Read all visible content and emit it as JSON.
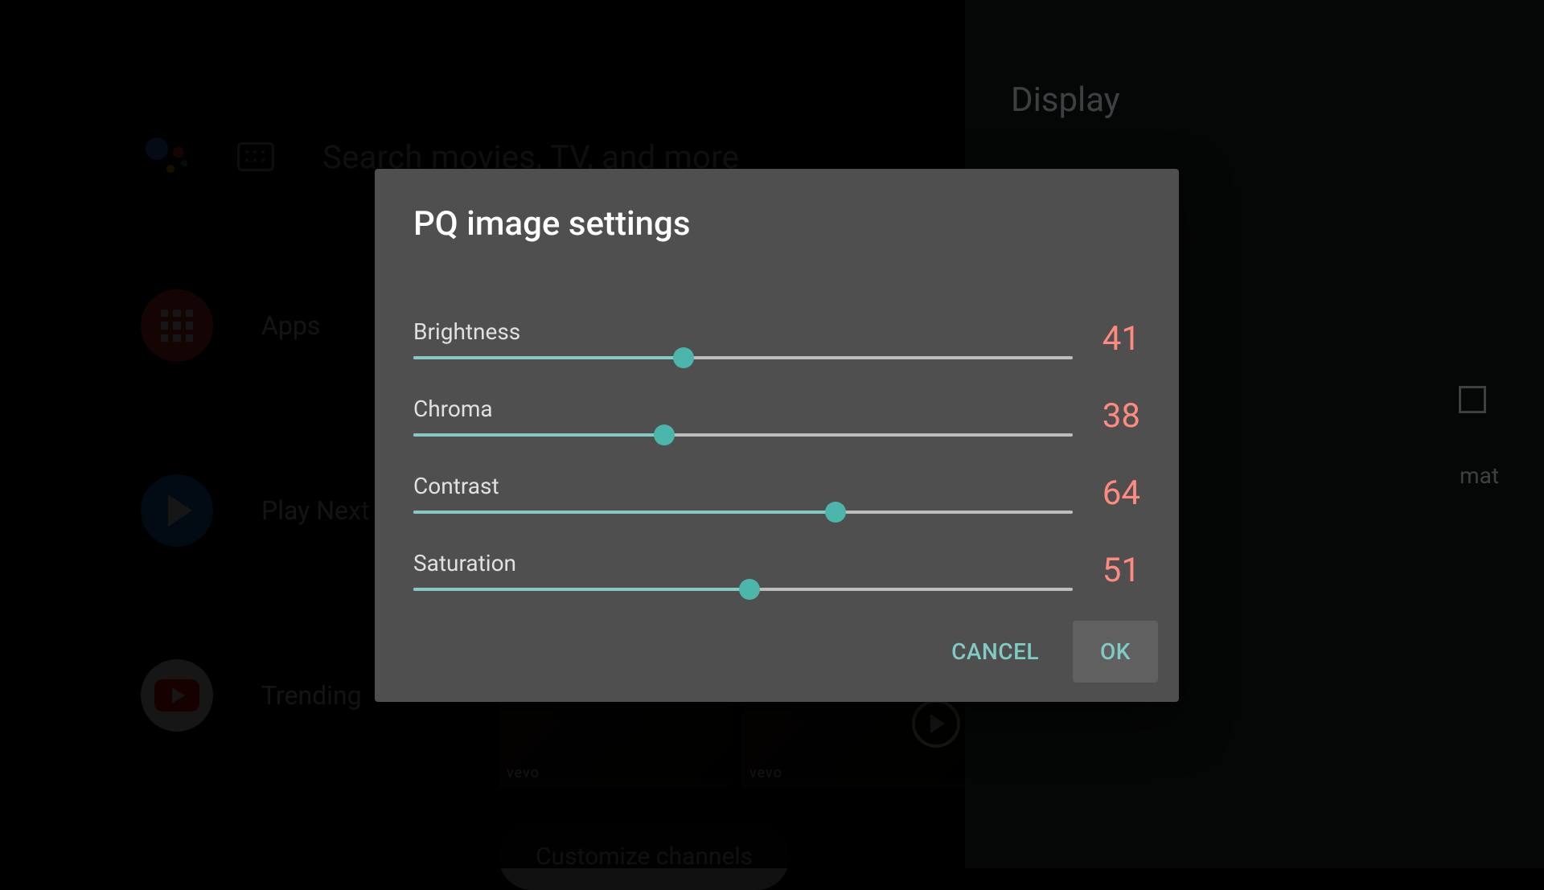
{
  "home": {
    "search_placeholder": "Search movies, TV, and more",
    "rows": {
      "apps": "Apps",
      "playnext": "Play Next",
      "trending": "Trending"
    },
    "customize": "Customize channels"
  },
  "drawer": {
    "title": "Display",
    "format_hint": "mat"
  },
  "dialog": {
    "title": "PQ image settings",
    "sliders": [
      {
        "label": "Brightness",
        "value": 41,
        "max": 100
      },
      {
        "label": "Chroma",
        "value": 38,
        "max": 100
      },
      {
        "label": "Contrast",
        "value": 64,
        "max": 100
      },
      {
        "label": "Saturation",
        "value": 51,
        "max": 100
      }
    ],
    "cancel": "CANCEL",
    "ok": "OK"
  },
  "colors": {
    "accent": "#80cbc4",
    "value": "#ff8a80"
  }
}
